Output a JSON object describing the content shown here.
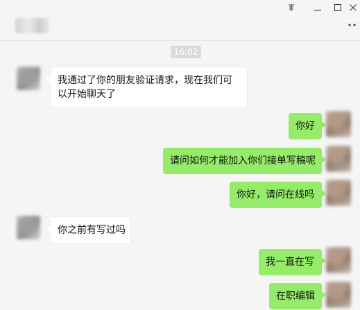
{
  "window": {
    "pin_icon": "pin-icon",
    "minimize_icon": "minimize-icon",
    "maximize_icon": "maximize-icon",
    "close_icon": "close-icon",
    "more_icon": "more-options-icon"
  },
  "chat": {
    "timestamp": "16:02",
    "messages": [
      {
        "sender": "friend",
        "text": "我通过了你的朋友验证请求，现在我们可以开始聊天了"
      },
      {
        "sender": "me",
        "text": "你好"
      },
      {
        "sender": "me",
        "text": "请问如何才能加入你们接单写稿呢"
      },
      {
        "sender": "me",
        "text": "你好，请问在线吗"
      },
      {
        "sender": "friend",
        "text": "你之前有写过吗"
      },
      {
        "sender": "me",
        "text": "我一直在写"
      },
      {
        "sender": "me",
        "text": "在职编辑"
      }
    ]
  },
  "colors": {
    "my_bubble": "#95ec69",
    "friend_bubble": "#ffffff",
    "background": "#f5f5f5"
  }
}
